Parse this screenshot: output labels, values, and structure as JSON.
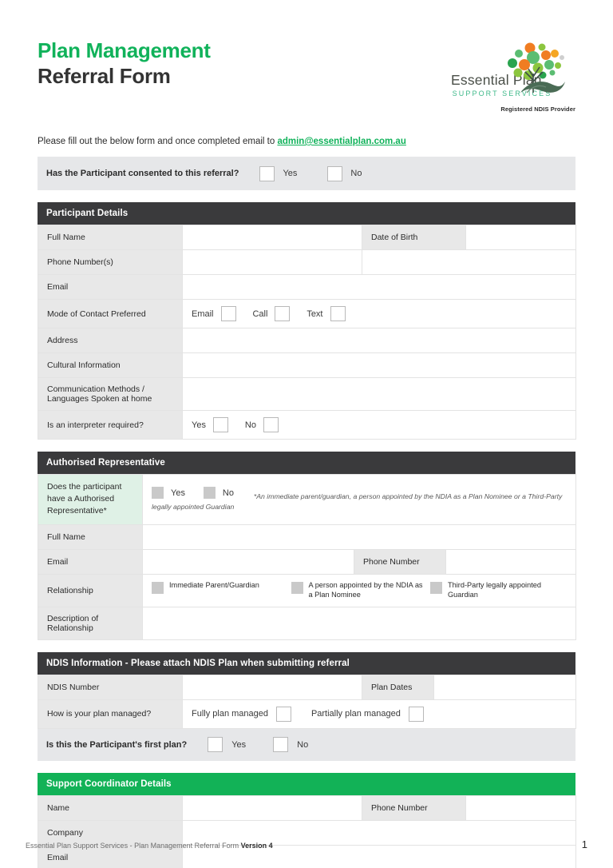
{
  "header": {
    "title_line1": "Plan Management",
    "title_line2": "Referral Form",
    "logo_word": "Essential Plan",
    "logo_sub": "SUPPORT SERVICES",
    "logo_ndis": "Registered NDIS Provider",
    "colors": {
      "green": "#10b25a",
      "dark": "#333333",
      "logo_teal": "#3fb98a"
    }
  },
  "intro": {
    "text": "Please fill out the below form and once completed email to ",
    "email": "admin@essentialplan.com.au"
  },
  "consent": {
    "question": "Has the Participant consented to this referral?",
    "yes": "Yes",
    "no": "No"
  },
  "participant": {
    "heading": "Participant Details",
    "full_name": "Full Name",
    "date_of_birth": "Date of Birth",
    "phone_numbers": "Phone Number(s)",
    "email": "Email",
    "mode_of_contact": "Mode of Contact Preferred",
    "mode_options": [
      "Email",
      "Call",
      "Text"
    ],
    "address": "Address",
    "cultural_information": "Cultural Information",
    "communication_methods": "Communication Methods / Languages Spoken at home",
    "interpreter": "Is an interpreter required?",
    "interpreter_yes": "Yes",
    "interpreter_no": "No"
  },
  "authorised": {
    "heading": "Authorised Representative",
    "question": "Does the participant have a Authorised Representative*",
    "yes": "Yes",
    "no": "No",
    "note": "*An immediate parent/guardian, a person appointed by the NDIA as a Plan Nominee or a Third-Party legally appointed Guardian",
    "full_name": "Full Name",
    "email": "Email",
    "phone_number": "Phone Number",
    "relationship": "Relationship",
    "relationship_options": [
      "Immediate Parent/Guardian",
      "A person appointed by the NDIA as a Plan Nominee",
      "Third-Party legally appointed Guardian"
    ],
    "description": "Description of Relationship"
  },
  "ndis": {
    "heading": "NDIS Information - Please attach NDIS Plan when submitting referral",
    "ndis_number": "NDIS Number",
    "plan_dates": "Plan Dates",
    "plan_managed_question": "How is your plan managed?",
    "plan_managed_options": [
      "Fully plan managed",
      "Partially plan managed"
    ],
    "first_plan_question": "Is this the Participant's first plan?",
    "first_plan_yes": "Yes",
    "first_plan_no": "No"
  },
  "support": {
    "heading": "Support Coordinator Details",
    "name": "Name",
    "phone_number": "Phone Number",
    "company": "Company",
    "email": "Email"
  },
  "footer": {
    "text_plain": "Essential Plan Support Services - Plan Management Referral Form ",
    "text_bold": "Version 4",
    "page": "1"
  }
}
